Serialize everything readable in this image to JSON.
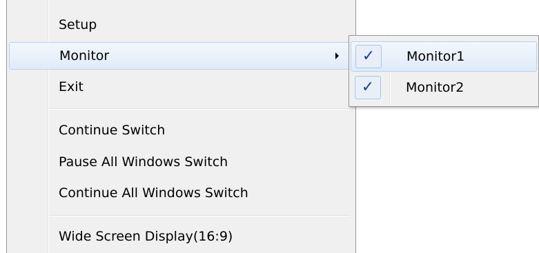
{
  "menu": {
    "items": [
      {
        "label": "Setup"
      },
      {
        "label": "Monitor"
      },
      {
        "label": "Exit"
      },
      {
        "label": "Continue Switch"
      },
      {
        "label": "Pause All Windows Switch"
      },
      {
        "label": "Continue All Windows Switch"
      },
      {
        "label": "Wide Screen Display(16:9)"
      }
    ]
  },
  "submenu": {
    "items": [
      {
        "label": "Monitor1",
        "checked": true,
        "check_glyph": "✓"
      },
      {
        "label": "Monitor2",
        "checked": true,
        "check_glyph": "✓"
      }
    ]
  },
  "colors": {
    "menu_background": "#f0f0f0",
    "hover_border": "#b4d0f6",
    "check_color": "#1b3f8b"
  },
  "icons": {
    "submenu_arrow": "chevron-right-icon",
    "check": "checkmark-icon"
  }
}
